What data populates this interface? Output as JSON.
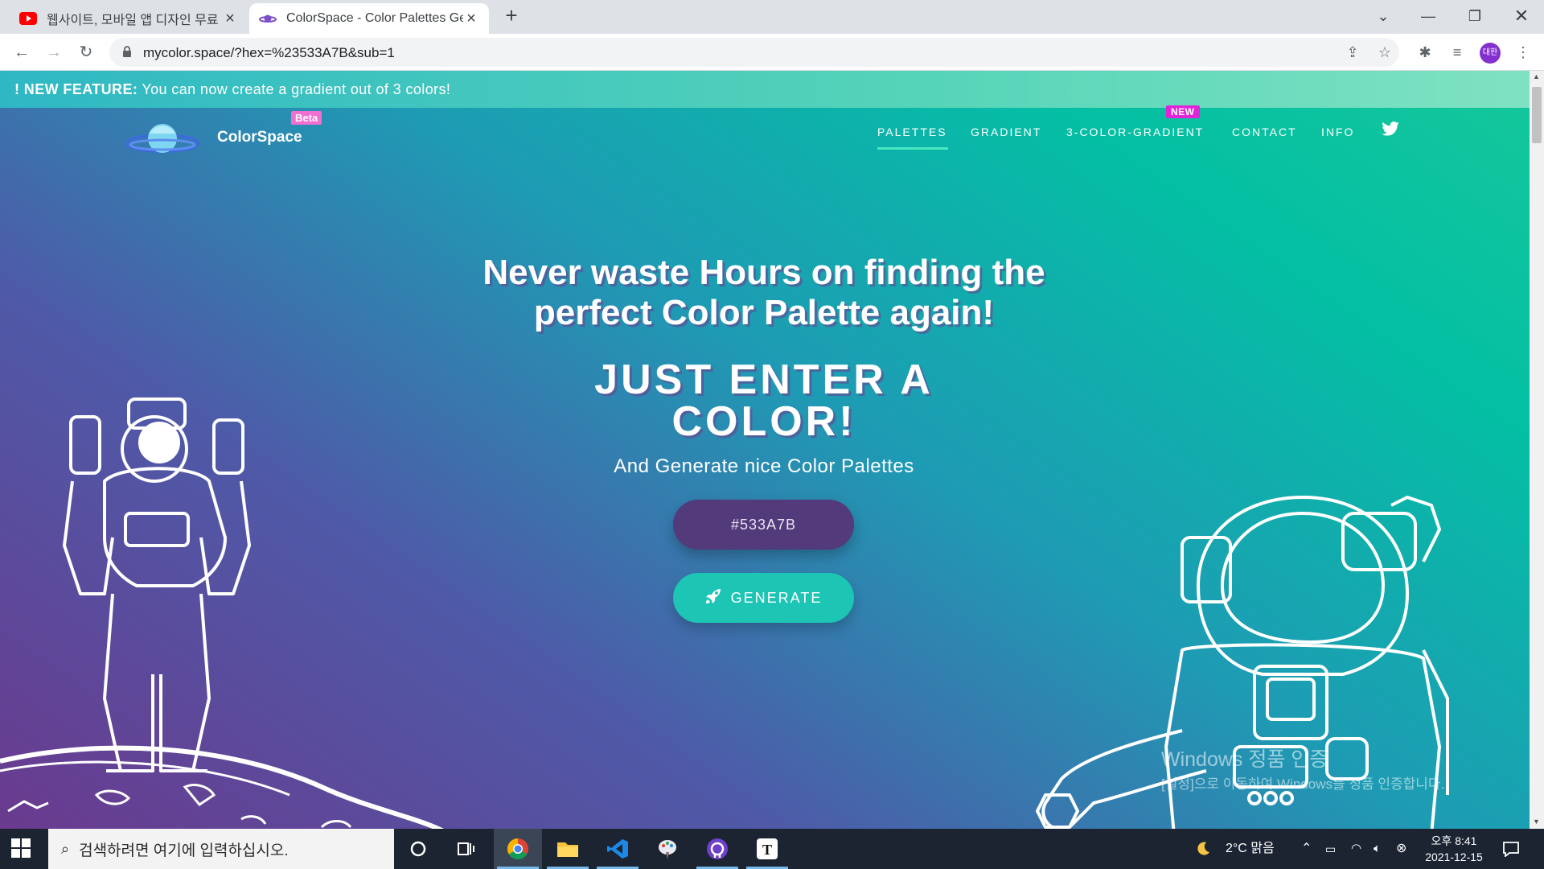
{
  "browser": {
    "tabs": [
      {
        "title": "웹사이트, 모바일 앱 디자인 무료",
        "active": false,
        "favicon": "youtube-icon"
      },
      {
        "title": "ColorSpace - Color Palettes Gen",
        "active": true,
        "favicon": "planet-icon"
      }
    ],
    "url": "mycolor.space/?hex=%23533A7B&sub=1",
    "profile_initials": "대한"
  },
  "page": {
    "banner": {
      "strong": "! NEW FEATURE:",
      "text": " You can now create a gradient out of 3 colors!"
    },
    "brand": {
      "name": "ColorSpace",
      "badge": "Beta"
    },
    "nav": {
      "items": [
        "PALETTES",
        "GRADIENT",
        "3-COLOR-GRADIENT",
        "CONTACT",
        "INFO"
      ],
      "active": "PALETTES",
      "new_badge": "NEW"
    },
    "hero": {
      "title_line1": "Never waste Hours on finding the",
      "title_line2": "perfect Color Palette again!",
      "subtitle_line1": "JUST ENTER A",
      "subtitle_line2": "COLOR!",
      "tagline": "And Generate nice Color Palettes"
    },
    "color_input": {
      "value": "#533A7B"
    },
    "generate_label": "GENERATE",
    "watermark": {
      "line1": "Windows 정품 인증",
      "line2": "[설정]으로 이동하여 Windows를 정품 인증합니다."
    }
  },
  "colors": {
    "input_bg": "#533a7b",
    "button_bg": "#1cc5b4",
    "accent": "#49e8c0"
  },
  "taskbar": {
    "search_placeholder": "검색하려면 여기에 입력하십시오.",
    "weather": "2°C 맑음",
    "time": "오후 8:41",
    "date": "2021-12-15"
  }
}
